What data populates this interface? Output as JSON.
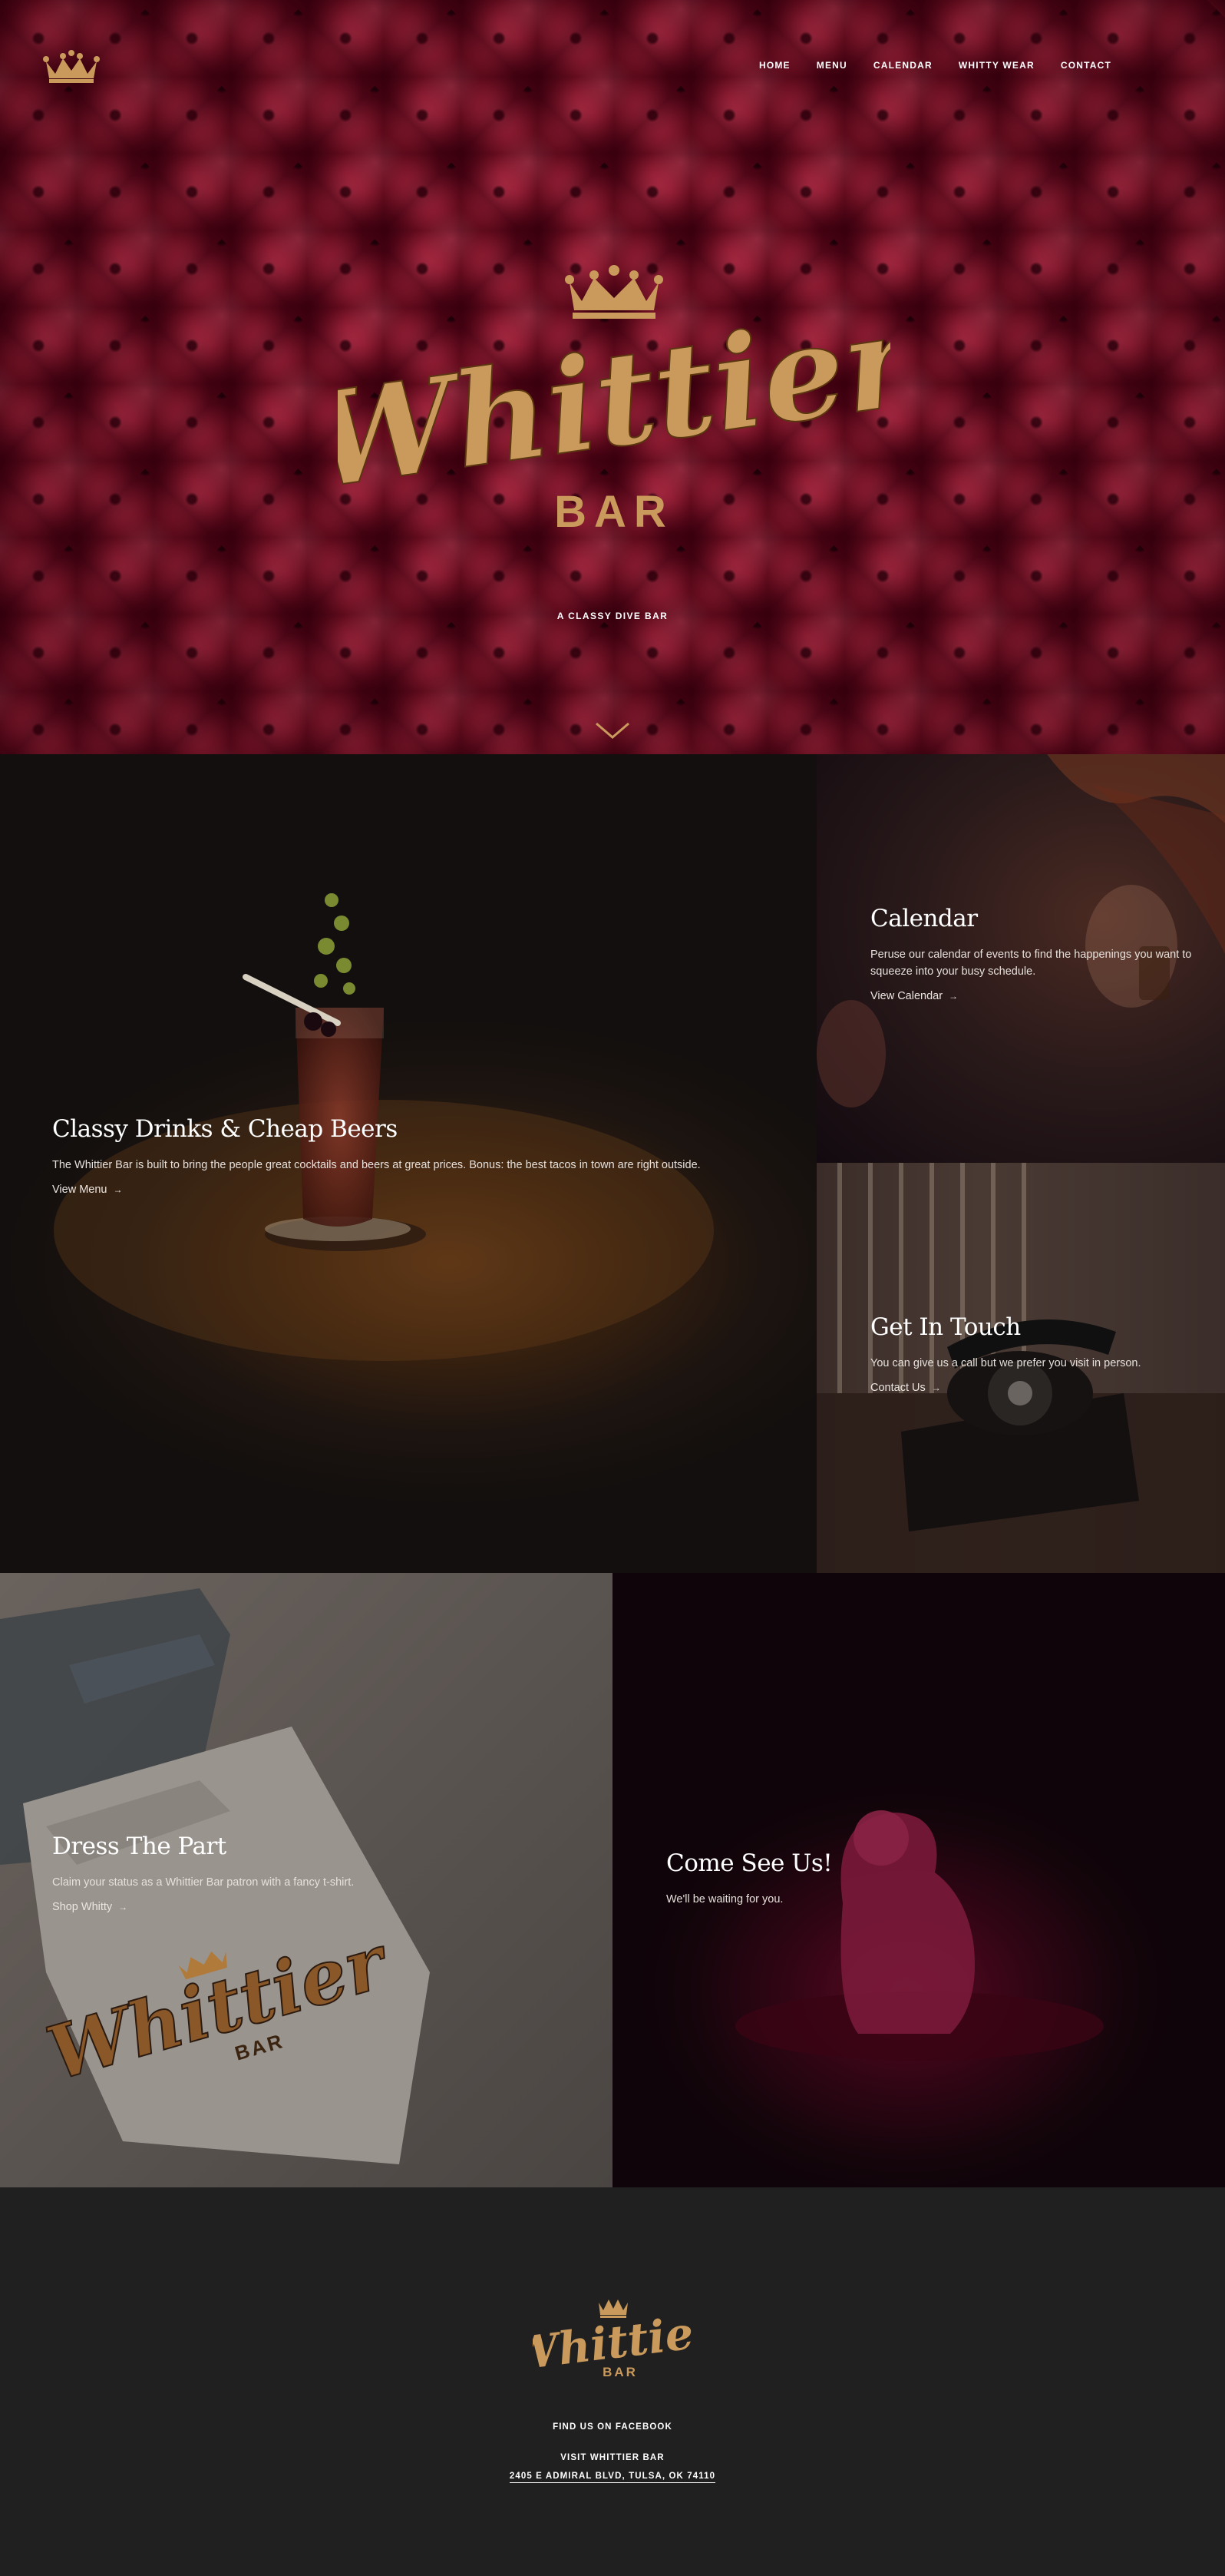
{
  "colors": {
    "gold": "#c99a5b",
    "velvet": "#8e1e33",
    "footer_bg": "#202020"
  },
  "nav": {
    "logo_icon": "crown-icon",
    "items": [
      "HOME",
      "MENU",
      "CALENDAR",
      "WHITTY WEAR",
      "CONTACT"
    ]
  },
  "hero": {
    "logo_script": "Whittier",
    "logo_sub": "BAR",
    "tagline": "A CLASSY DIVE BAR",
    "scroll_icon": "chevron-down-icon"
  },
  "tiles": {
    "drinks": {
      "title": "Classy Drinks & Cheap Beers",
      "text": "The Whittier Bar is built to bring the people great cocktails and beers at great prices. Bonus: the best tacos in town are right outside.",
      "link": "View Menu"
    },
    "calendar": {
      "title": "Calendar",
      "text": "Peruse our calendar of events to find the happenings you want to squeeze into your busy schedule.",
      "link": "View Calendar"
    },
    "touch": {
      "title": "Get In Touch",
      "text": "You can give us a call but we prefer you visit in person.",
      "link": "Contact Us"
    },
    "dress": {
      "title": "Dress The Part",
      "text": "Claim your status as a Whittier Bar patron with a fancy t-shirt.",
      "link": "Shop Whitty",
      "shirt_logo_script": "Whittier",
      "shirt_logo_sub": "BAR"
    },
    "come": {
      "title": "Come See Us!",
      "text": "We'll be waiting for you."
    },
    "arrow": "→"
  },
  "footer": {
    "logo_script": "Whittier",
    "logo_sub": "BAR",
    "facebook": "FIND US ON FACEBOOK",
    "visit": "VISIT WHITTIER BAR",
    "address": "2405 E ADMIRAL BLVD, TULSA, OK 74110"
  }
}
